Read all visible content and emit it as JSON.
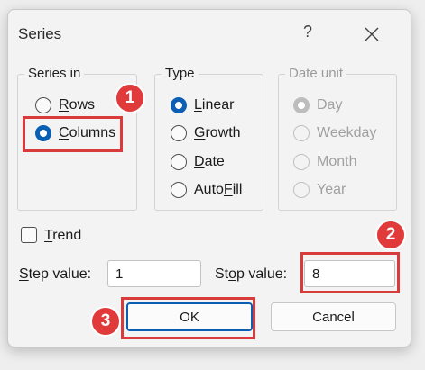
{
  "dialog": {
    "title": "Series",
    "help_glyph": "?",
    "close_icon": "close-icon"
  },
  "series_in": {
    "label": "Series in",
    "options": [
      {
        "pre": "",
        "accel": "R",
        "post": "ows",
        "checked": false
      },
      {
        "pre": "",
        "accel": "C",
        "post": "olumns",
        "checked": true
      }
    ]
  },
  "type": {
    "label": "Type",
    "options": [
      {
        "pre": "",
        "accel": "L",
        "post": "inear",
        "checked": true
      },
      {
        "pre": "",
        "accel": "G",
        "post": "rowth",
        "checked": false
      },
      {
        "pre": "",
        "accel": "D",
        "post": "ate",
        "checked": false
      },
      {
        "pre": "Auto",
        "accel": "F",
        "post": "ill",
        "checked": false
      }
    ]
  },
  "date_unit": {
    "label": "Date unit",
    "enabled": false,
    "options": [
      {
        "text": "Day",
        "checked": true
      },
      {
        "text": "Weekday",
        "checked": false
      },
      {
        "text": "Month",
        "checked": false
      },
      {
        "text": "Year",
        "checked": false
      }
    ]
  },
  "trend": {
    "accel": "T",
    "post": "rend",
    "checked": false
  },
  "step": {
    "accel": "S",
    "post": "tep value:",
    "value": "1"
  },
  "stop": {
    "pre": "St",
    "accel": "o",
    "post": "p value:",
    "value": "8"
  },
  "buttons": {
    "ok": "OK",
    "cancel": "Cancel"
  },
  "annotations": {
    "badge_1": "1",
    "badge_2": "2",
    "badge_3": "3",
    "highlight_color": "#d93b3b"
  },
  "colors": {
    "accent": "#0a5fb4",
    "annotation": "#e13a3a"
  }
}
